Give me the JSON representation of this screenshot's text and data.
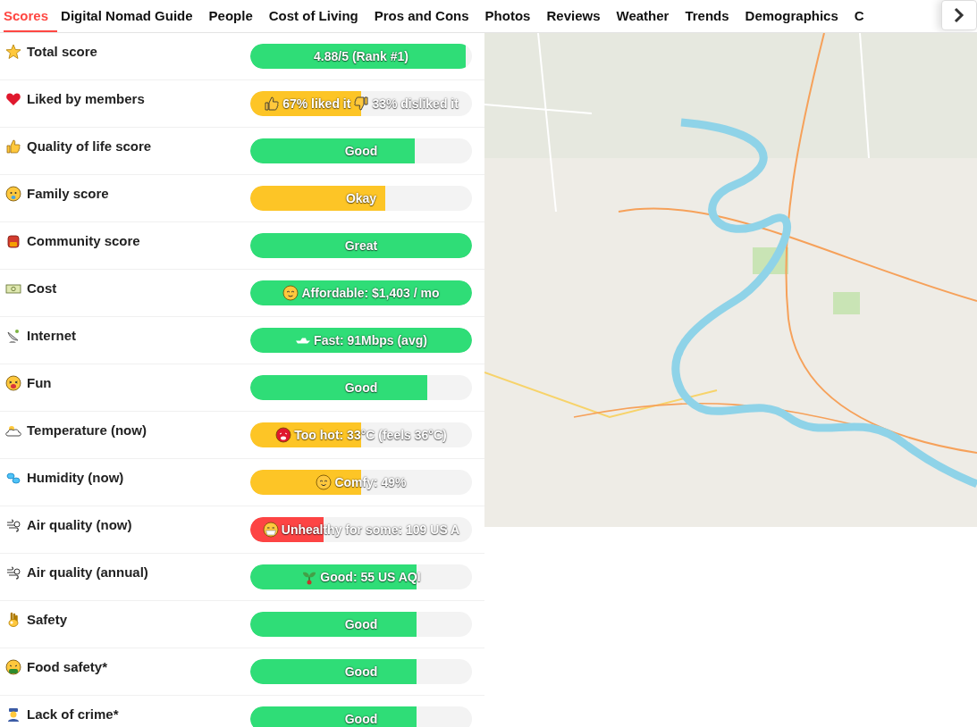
{
  "tabs": [
    {
      "label": "Scores",
      "selected": true
    },
    {
      "label": "Digital Nomad Guide",
      "selected": false
    },
    {
      "label": "People",
      "selected": false
    },
    {
      "label": "Cost of Living",
      "selected": false
    },
    {
      "label": "Pros and Cons",
      "selected": false
    },
    {
      "label": "Photos",
      "selected": false
    },
    {
      "label": "Reviews",
      "selected": false
    },
    {
      "label": "Weather",
      "selected": false
    },
    {
      "label": "Trends",
      "selected": false
    },
    {
      "label": "Demographics",
      "selected": false
    },
    {
      "label": "C",
      "selected": false
    }
  ],
  "scores": [
    {
      "label": "Total score",
      "value": "4.88/5 (Rank #1)",
      "level": 0.97,
      "color": "#2fdd77"
    },
    {
      "label": "Liked by members",
      "value": "67% liked it",
      "value_2": "33% disliked it",
      "level": 0.5,
      "color": "#fdc526"
    },
    {
      "label": "Quality of life score",
      "value": "Good",
      "level": 0.74,
      "color": "#2fdd77"
    },
    {
      "label": "Family score",
      "value": "Okay",
      "level": 0.61,
      "color": "#fdc526"
    },
    {
      "label": "Community score",
      "value": "Great",
      "level": 1,
      "color": "#2fdd77"
    },
    {
      "label": "Cost",
      "value": "Affordable: $1,403 / mo",
      "level": 1,
      "color": "#2fdd77"
    },
    {
      "label": "Internet",
      "value": "Fast: 91Mbps (avg)",
      "level": 1,
      "color": "#2fdd77"
    },
    {
      "label": "Fun",
      "value": "Good",
      "level": 0.8,
      "color": "#2fdd77"
    },
    {
      "label": "Temperature (now)",
      "value": "Too hot: 33°C (feels 36°C)",
      "level": 0.5,
      "color": "#fdc526"
    },
    {
      "label": "Humidity (now)",
      "value": "Comfy: 49%",
      "level": 0.5,
      "color": "#fdc526"
    },
    {
      "label": "Air quality (now)",
      "value": "Unhealthy for some: 109 US A",
      "level": 0.33,
      "color": "#fd4444"
    },
    {
      "label": "Air quality (annual)",
      "value": "Good: 55 US AQI",
      "level": 0.75,
      "color": "#2fdd77"
    },
    {
      "label": "Safety",
      "value": "Good",
      "level": 0.75,
      "color": "#2fdd77"
    },
    {
      "label": "Food safety*",
      "value": "Good",
      "level": 0.75,
      "color": "#2fdd77"
    },
    {
      "label": "Lack of crime*",
      "value": "Good",
      "level": 0.75,
      "color": "#2fdd77"
    }
  ]
}
